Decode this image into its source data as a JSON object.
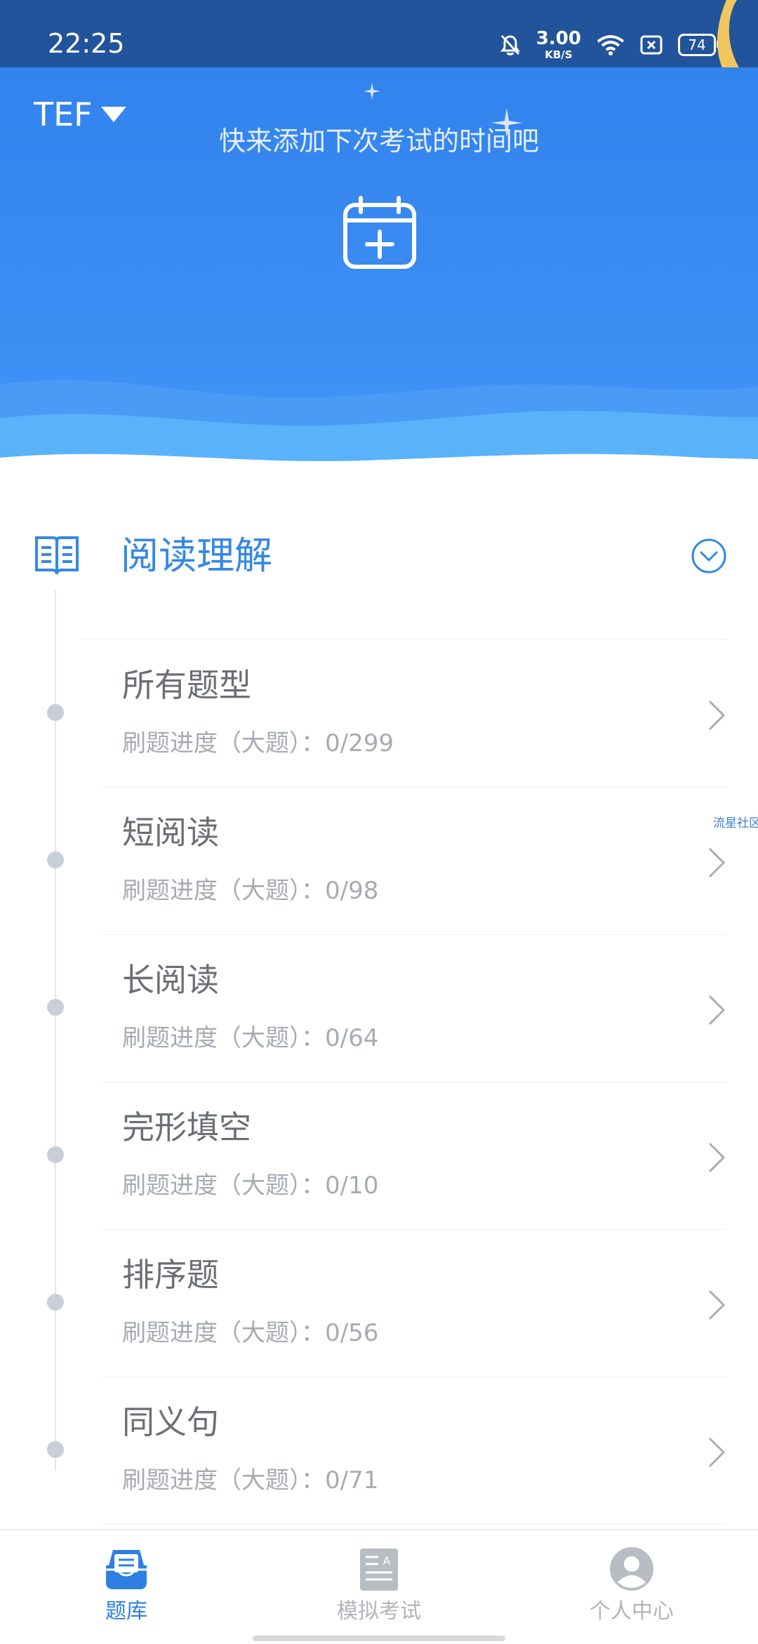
{
  "status_bar": {
    "time": "22:25",
    "net_speed_value": "3.00",
    "net_speed_unit": "KB/S",
    "battery": "74",
    "icons": [
      "bell-muted-icon",
      "wifi-icon",
      "sim-off-icon",
      "battery-icon"
    ]
  },
  "header": {
    "exam_type": "TEF",
    "add_exam_prompt": "快来添加下次考试的时间吧",
    "add_exam_icon": "calendar-plus-icon"
  },
  "section": {
    "title": "阅读理解",
    "icon": "book-icon",
    "collapse_icon": "chevron-circle-down-icon"
  },
  "categories": [
    {
      "title": "所有题型",
      "progress": "刷题进度（大题）：0/299"
    },
    {
      "title": "短阅读",
      "progress": "刷题进度（大题）：0/98"
    },
    {
      "title": "长阅读",
      "progress": "刷题进度（大题）：0/64"
    },
    {
      "title": "完形填空",
      "progress": "刷题进度（大题）：0/10"
    },
    {
      "title": "排序题",
      "progress": "刷题进度（大题）：0/56"
    },
    {
      "title": "同义句",
      "progress": "刷题进度（大题）：0/71"
    }
  ],
  "side_watermark": "流星社区",
  "bottom_nav": {
    "items": [
      {
        "label": "题库",
        "icon": "question-bank-icon",
        "active": true
      },
      {
        "label": "模拟考试",
        "icon": "mock-exam-icon",
        "active": false
      },
      {
        "label": "个人中心",
        "icon": "profile-icon",
        "active": false
      }
    ]
  },
  "colors": {
    "status_bar": "#22549b",
    "hero_blue": "#3283ee",
    "accent": "#3488e6",
    "wave_light": "#5ab2fb"
  }
}
